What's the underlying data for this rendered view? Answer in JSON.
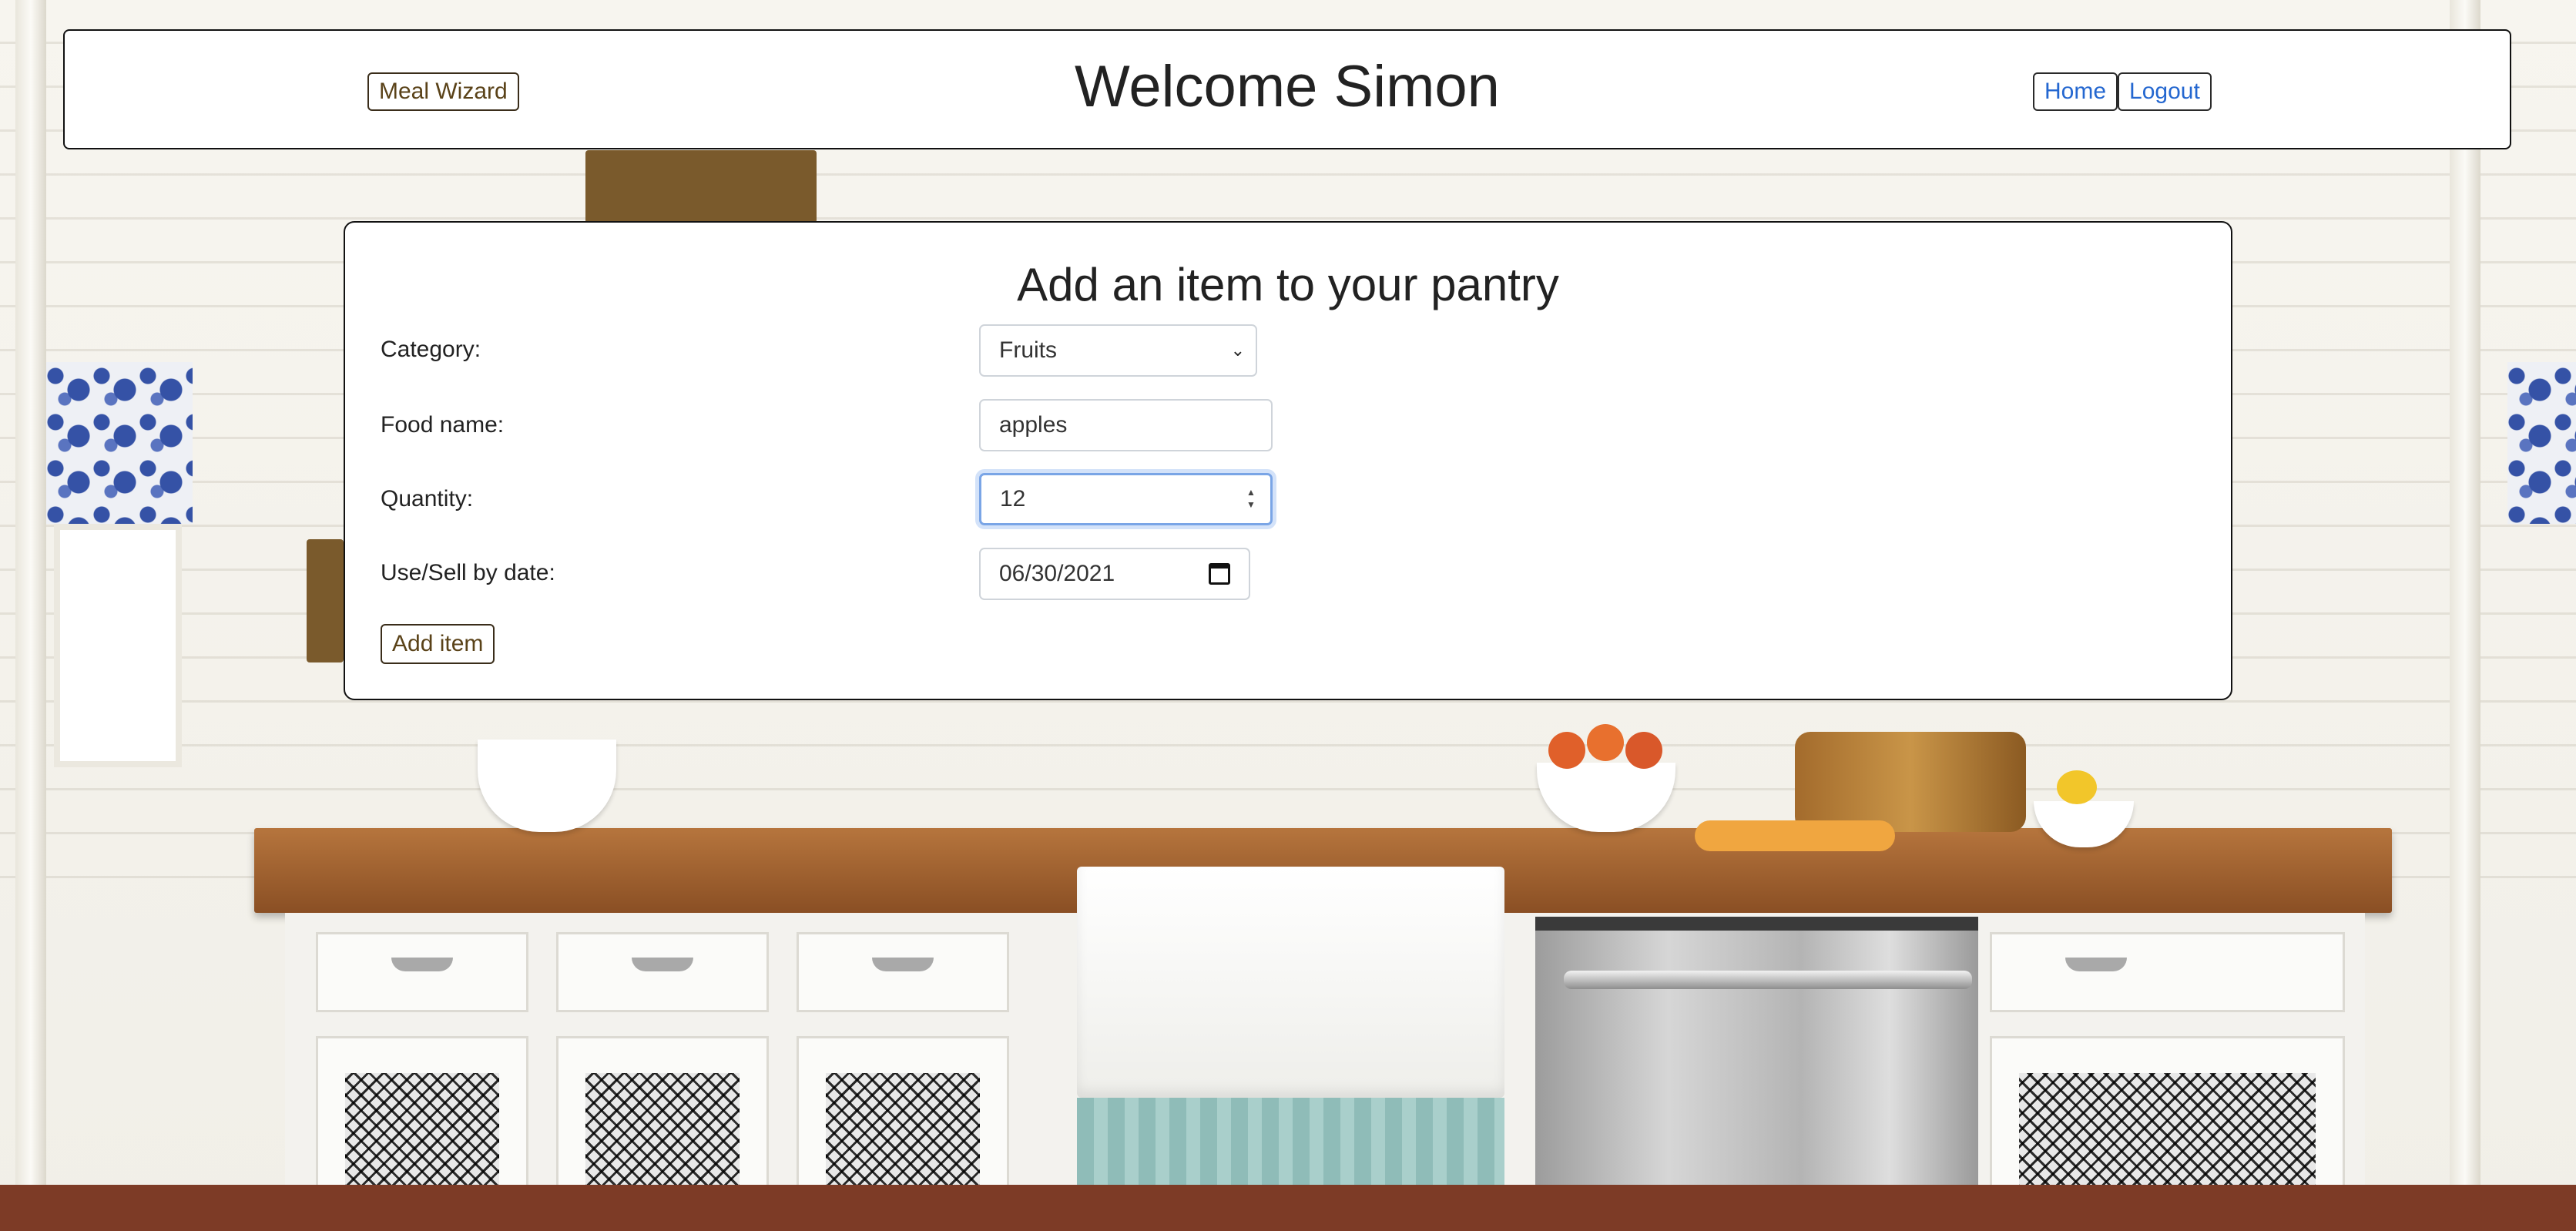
{
  "header": {
    "wizard_label": "Meal Wizard",
    "welcome": "Welcome Simon",
    "nav": {
      "home": "Home",
      "logout": "Logout"
    }
  },
  "form": {
    "title": "Add an item to your pantry",
    "category": {
      "label": "Category:",
      "value": "Fruits"
    },
    "food_name": {
      "label": "Food name:",
      "value": "apples"
    },
    "quantity": {
      "label": "Quantity:",
      "value": "12"
    },
    "date": {
      "label": "Use/Sell by date:",
      "value": "06/30/2021"
    },
    "submit_label": "Add item"
  },
  "icons": {
    "select_arrow": "chevron-down-icon",
    "spinner": "number-spinner-icon",
    "calendar": "calendar-icon"
  },
  "colors": {
    "link_blue": "#2467d0",
    "brown_text": "#5a4218",
    "focus_ring": "#7aa5e6",
    "countertop": "#9a5c2c"
  }
}
